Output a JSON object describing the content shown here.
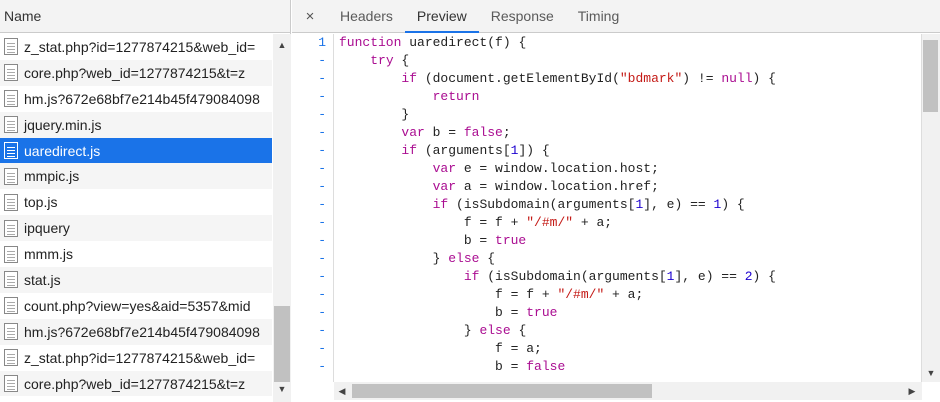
{
  "left_panel": {
    "header": "Name",
    "files": [
      "z_stat.php?id=1277874215&web_id=",
      "core.php?web_id=1277874215&t=z",
      "hm.js?672e68bf7e214b45f479084098",
      "jquery.min.js",
      "uaredirect.js",
      "mmpic.js",
      "top.js",
      "ipquery",
      "mmm.js",
      "stat.js",
      "count.php?view=yes&aid=5357&mid",
      "hm.js?672e68bf7e214b45f479084098",
      "z_stat.php?id=1277874215&web_id=",
      "core.php?web_id=1277874215&t=z"
    ],
    "selected_index": 4
  },
  "tabs": {
    "close_icon": "×",
    "items": [
      "Headers",
      "Preview",
      "Response",
      "Timing"
    ],
    "active_index": 1
  },
  "code": {
    "gutter": [
      "1",
      "-",
      "-",
      "-",
      "-",
      "-",
      "-",
      "-",
      "-",
      "-",
      "-",
      "-",
      "-",
      "-",
      "-",
      "-",
      "-",
      "-",
      "-"
    ],
    "lines": [
      [
        [
          "kw",
          "function"
        ],
        [
          "t",
          " uaredirect(f) {"
        ]
      ],
      [
        [
          "t",
          "    "
        ],
        [
          "kw",
          "try"
        ],
        [
          "t",
          " {"
        ]
      ],
      [
        [
          "t",
          "        "
        ],
        [
          "kw",
          "if"
        ],
        [
          "t",
          " (document.getElementById("
        ],
        [
          "str",
          "\"bdmark\""
        ],
        [
          "t",
          ") != "
        ],
        [
          "kw",
          "null"
        ],
        [
          "t",
          ") {"
        ]
      ],
      [
        [
          "t",
          "            "
        ],
        [
          "kw",
          "return"
        ]
      ],
      [
        [
          "t",
          "        }"
        ]
      ],
      [
        [
          "t",
          "        "
        ],
        [
          "kw",
          "var"
        ],
        [
          "t",
          " b = "
        ],
        [
          "kw",
          "false"
        ],
        [
          "t",
          ";"
        ]
      ],
      [
        [
          "t",
          "        "
        ],
        [
          "kw",
          "if"
        ],
        [
          "t",
          " (arguments["
        ],
        [
          "num",
          "1"
        ],
        [
          "t",
          "]) {"
        ]
      ],
      [
        [
          "t",
          "            "
        ],
        [
          "kw",
          "var"
        ],
        [
          "t",
          " e = window.location.host;"
        ]
      ],
      [
        [
          "t",
          "            "
        ],
        [
          "kw",
          "var"
        ],
        [
          "t",
          " a = window.location.href;"
        ]
      ],
      [
        [
          "t",
          "            "
        ],
        [
          "kw",
          "if"
        ],
        [
          "t",
          " (isSubdomain(arguments["
        ],
        [
          "num",
          "1"
        ],
        [
          "t",
          "], e) == "
        ],
        [
          "num",
          "1"
        ],
        [
          "t",
          ") {"
        ]
      ],
      [
        [
          "t",
          "                f = f + "
        ],
        [
          "str",
          "\"/#m/\""
        ],
        [
          "t",
          " + a;"
        ]
      ],
      [
        [
          "t",
          "                b = "
        ],
        [
          "kw",
          "true"
        ]
      ],
      [
        [
          "t",
          "            } "
        ],
        [
          "kw",
          "else"
        ],
        [
          "t",
          " {"
        ]
      ],
      [
        [
          "t",
          "                "
        ],
        [
          "kw",
          "if"
        ],
        [
          "t",
          " (isSubdomain(arguments["
        ],
        [
          "num",
          "1"
        ],
        [
          "t",
          "], e) == "
        ],
        [
          "num",
          "2"
        ],
        [
          "t",
          ") {"
        ]
      ],
      [
        [
          "t",
          "                    f = f + "
        ],
        [
          "str",
          "\"/#m/\""
        ],
        [
          "t",
          " + a;"
        ]
      ],
      [
        [
          "t",
          "                    b = "
        ],
        [
          "kw",
          "true"
        ]
      ],
      [
        [
          "t",
          "                } "
        ],
        [
          "kw",
          "else"
        ],
        [
          "t",
          " {"
        ]
      ],
      [
        [
          "t",
          "                    f = a;"
        ]
      ],
      [
        [
          "t",
          "                    b = "
        ],
        [
          "kw",
          "false"
        ]
      ]
    ]
  },
  "colors": {
    "selection": "#1a73e8",
    "keyword": "#aa0d91",
    "string": "#c41a16",
    "number": "#1c00cf"
  }
}
